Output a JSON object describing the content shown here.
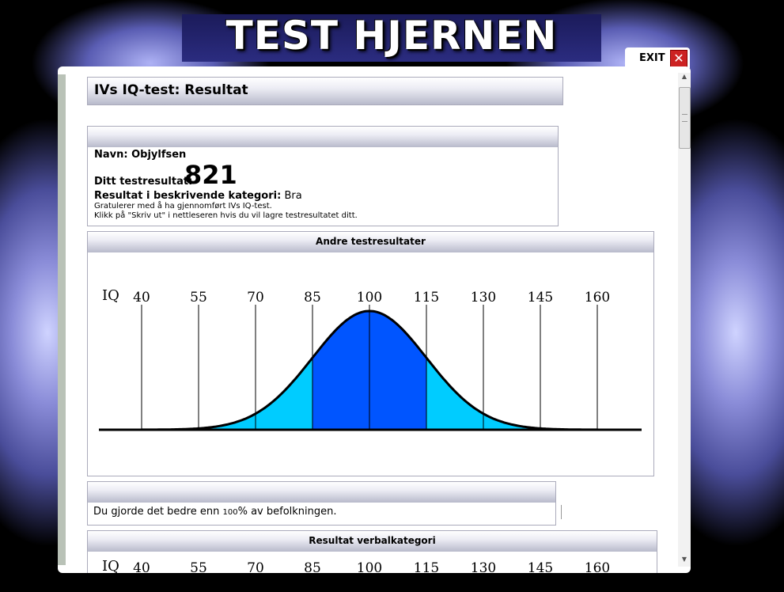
{
  "header": {
    "site_title": "TEST HJERNEN",
    "exit_label": "EXIT",
    "close_icon": "close-icon"
  },
  "page": {
    "title": "IVs IQ-test: Resultat"
  },
  "info": {
    "name_label": "Navn: Objylfsen",
    "score_label": "Ditt testresultat:",
    "score": "821",
    "category_label": "Resultat i beskrivende kategori:",
    "category_value": "Bra",
    "congrats": "Gratulerer med å ha gjennomført IVs IQ-test.",
    "print_hint": "Klikk på \"Skriv ut\" i nettleseren hvis du vil lagre testresultatet ditt."
  },
  "chart1": {
    "title": "Andre testresultater"
  },
  "percentile": {
    "prefix": "Du gjorde det bedre enn",
    "value": "100",
    "suffix": "% av befolkningen."
  },
  "chart2": {
    "title": "Resultat verbalkategori"
  },
  "chart_data": {
    "type": "area",
    "title": "Andre testresultater",
    "ylabel": "IQ",
    "x_ticks": [
      40,
      55,
      70,
      85,
      100,
      115,
      130,
      145,
      160
    ],
    "distribution": {
      "mean": 100,
      "sd": 15
    },
    "bands": [
      {
        "from": 70,
        "to": 85,
        "color": "#00ccff"
      },
      {
        "from": 85,
        "to": 115,
        "color": "#0055ff"
      },
      {
        "from": 115,
        "to": 130,
        "color": "#00ccff"
      }
    ],
    "band_colors": {
      "outer": "#00ccff",
      "inner": "#0055ff"
    }
  }
}
